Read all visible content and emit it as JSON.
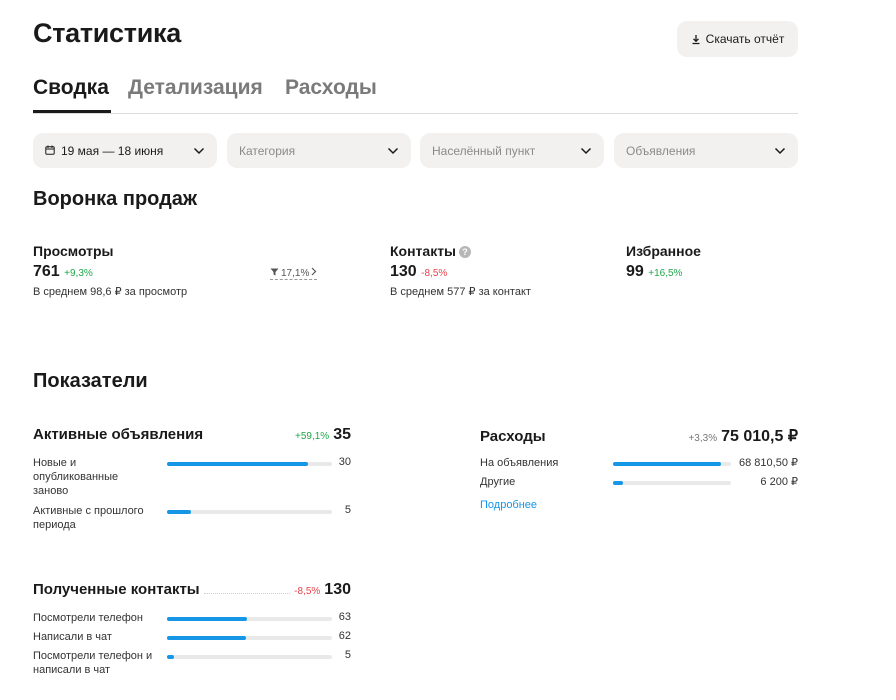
{
  "header": {
    "title": "Статистика",
    "download_label": "Скачать отчёт"
  },
  "tabs": [
    {
      "label": "Сводка",
      "active": true
    },
    {
      "label": "Детализация",
      "active": false
    },
    {
      "label": "Расходы",
      "active": false
    }
  ],
  "filters": {
    "date": "19 мая — 18 июня",
    "category_placeholder": "Категория",
    "locality_placeholder": "Населённый пункт",
    "listings_placeholder": "Объявления"
  },
  "funnel": {
    "title": "Воронка продаж",
    "views": {
      "label": "Просмотры",
      "value": "761",
      "change": "+9,3%",
      "note": "В среднем 98,6 ₽ за просмотр"
    },
    "conversion": "17,1%",
    "contacts": {
      "label": "Контакты",
      "value": "130",
      "change": "-8,5%",
      "note": "В среднем 577 ₽ за контакт",
      "help": "?"
    },
    "favorites": {
      "label": "Избранное",
      "value": "99",
      "change": "+16,5%"
    }
  },
  "indicators": {
    "title": "Показатели",
    "active_listings": {
      "title": "Активные объявления",
      "change": "+59,1%",
      "total": "35",
      "rows": [
        {
          "label": "Новые и опубликованные заново",
          "value": "30",
          "fraction": 0.857
        },
        {
          "label": "Активные с прошлого периода",
          "value": "5",
          "fraction": 0.143
        }
      ]
    },
    "expenses": {
      "title": "Расходы",
      "change": "+3,3%",
      "total": "75 010,5 ₽",
      "rows": [
        {
          "label": "На объявления",
          "value": "68 810,50 ₽",
          "fraction": 0.917
        },
        {
          "label": "Другие",
          "value": "6 200 ₽",
          "fraction": 0.083
        }
      ],
      "more_link": "Подробнее"
    },
    "contacts_received": {
      "title": "Полученные контакты",
      "change": "-8,5%",
      "total": "130",
      "rows": [
        {
          "label": "Посмотрели телефон",
          "value": "63",
          "fraction": 0.485
        },
        {
          "label": "Написали в чат",
          "value": "62",
          "fraction": 0.477
        },
        {
          "label": "Посмотрели телефон и написали в чат",
          "value": "5",
          "fraction": 0.038
        }
      ]
    }
  },
  "colors": {
    "accent": "#1596e6",
    "positive": "#1fa84a",
    "negative": "#e8434c",
    "surface": "#f2f1f0"
  }
}
